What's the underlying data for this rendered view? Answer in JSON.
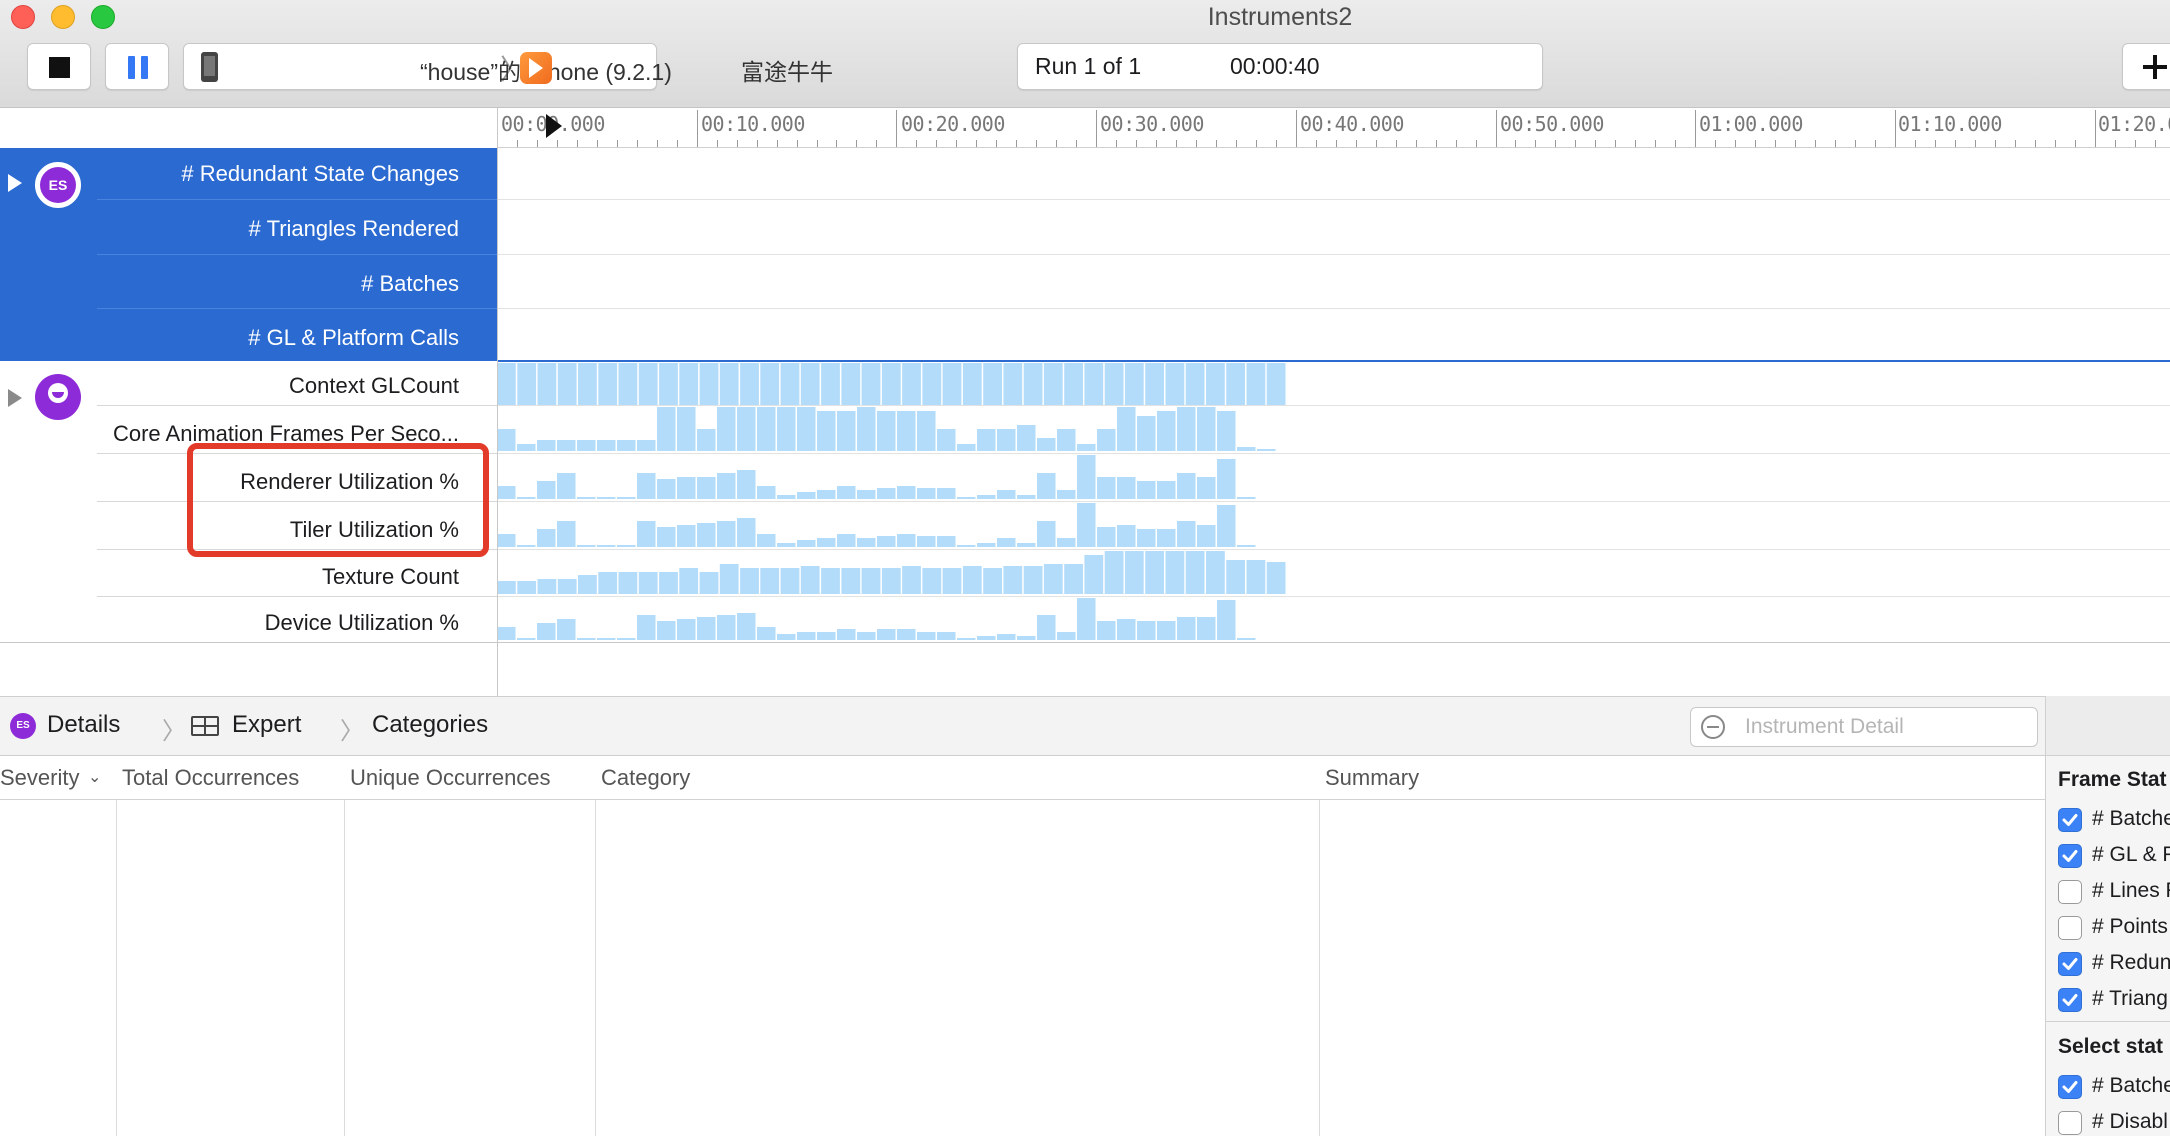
{
  "window": {
    "title": "Instruments2"
  },
  "toolbar": {
    "target": "“house”的 iPhone (9.2.1)",
    "app": "富途牛牛",
    "run_label": "Run 1 of 1",
    "elapsed": "00:00:40",
    "icons": {
      "stop": "stop-icon",
      "pause": "pause-icon",
      "device": "iphone-icon",
      "app": "app-icon",
      "add": "plus-icon"
    }
  },
  "ruler": {
    "ticks": [
      "00:00.000",
      "00:10.000",
      "00:20.000",
      "00:30.000",
      "00:40.000",
      "00:50.000",
      "01:00.000",
      "01:10.000",
      "01:20.0"
    ]
  },
  "tracks": {
    "group1": {
      "icon": "es-icon",
      "labels": [
        "# Redundant State Changes",
        "# Triangles Rendered",
        "# Batches",
        "# GL & Platform Calls"
      ]
    },
    "group2": {
      "icon": "core-animation-icon",
      "labels": [
        "Context GLCount",
        "Core Animation Frames Per Seco...",
        "Renderer Utilization %",
        "Tiler Utilization %",
        "Texture Count",
        "Device Utilization %"
      ]
    }
  },
  "colors": {
    "selection": "#2a6ad1",
    "bar": "#b3dcfa",
    "highlight": "#e23b2a",
    "checkbox": "#3b82f6"
  },
  "details_bar": {
    "crumbs": [
      "Details",
      "Expert",
      "Categories"
    ],
    "search_placeholder": "Instrument Detail"
  },
  "table": {
    "columns": [
      "Severity",
      "Total Occurrences",
      "Unique Occurrences",
      "Category",
      "Summary"
    ]
  },
  "inspector": {
    "section1": "Frame Stat",
    "section1_items": [
      {
        "label": "# Batche",
        "checked": true
      },
      {
        "label": "# GL & P",
        "checked": true
      },
      {
        "label": "# Lines R",
        "checked": false
      },
      {
        "label": "# Points",
        "checked": false
      },
      {
        "label": "# Redun",
        "checked": true
      },
      {
        "label": "# Triang",
        "checked": true
      }
    ],
    "section2": "Select stat",
    "section2_items": [
      {
        "label": "# Batche",
        "checked": true
      },
      {
        "label": "# Disabl",
        "checked": false
      }
    ]
  }
}
